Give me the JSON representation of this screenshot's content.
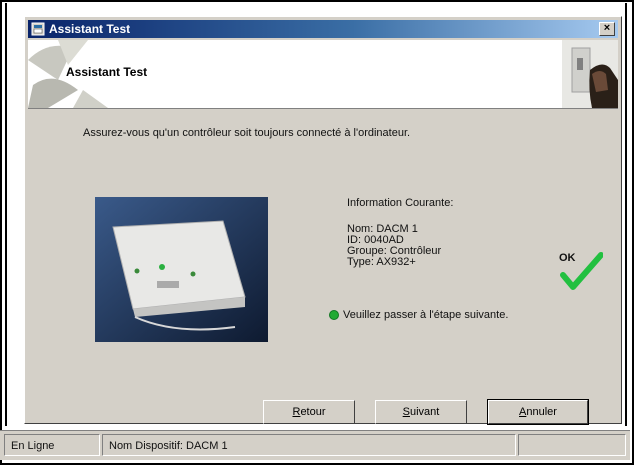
{
  "window": {
    "title": "Assistant Test",
    "close_glyph": "×"
  },
  "header": {
    "title": "Assistant Test"
  },
  "instruction": "Assurez-vous qu'un contrôleur soit toujours connecté à l'ordinateur.",
  "info": {
    "heading": "Information Courante:",
    "name": "Nom: DACM 1",
    "id": "ID: 0040AD",
    "group": "Groupe: Contrôleur",
    "type": "Type: AX932+"
  },
  "next_step": "Veuillez passer à l'étape suivante.",
  "ok_label": "OK",
  "buttons": {
    "retour": {
      "mnemonic": "R",
      "rest": "etour"
    },
    "suivant": {
      "mnemonic": "S",
      "rest": "uivant"
    },
    "annuler": {
      "mnemonic": "A",
      "rest": "nnuler"
    }
  },
  "statusbar": {
    "mode": "En Ligne",
    "device": "Nom Dispositif: DACM 1"
  },
  "colors": {
    "title_gradient_start": "#0a246a",
    "title_gradient_end": "#a6caf0",
    "dialog_face": "#d4d0c8",
    "ok_check": "#22c040",
    "status_dot": "#22aa33"
  },
  "icons": {
    "title_icon": "app-window-icon",
    "close": "close-icon",
    "ok": "checkmark-icon",
    "status_dot": "green-dot-icon"
  }
}
